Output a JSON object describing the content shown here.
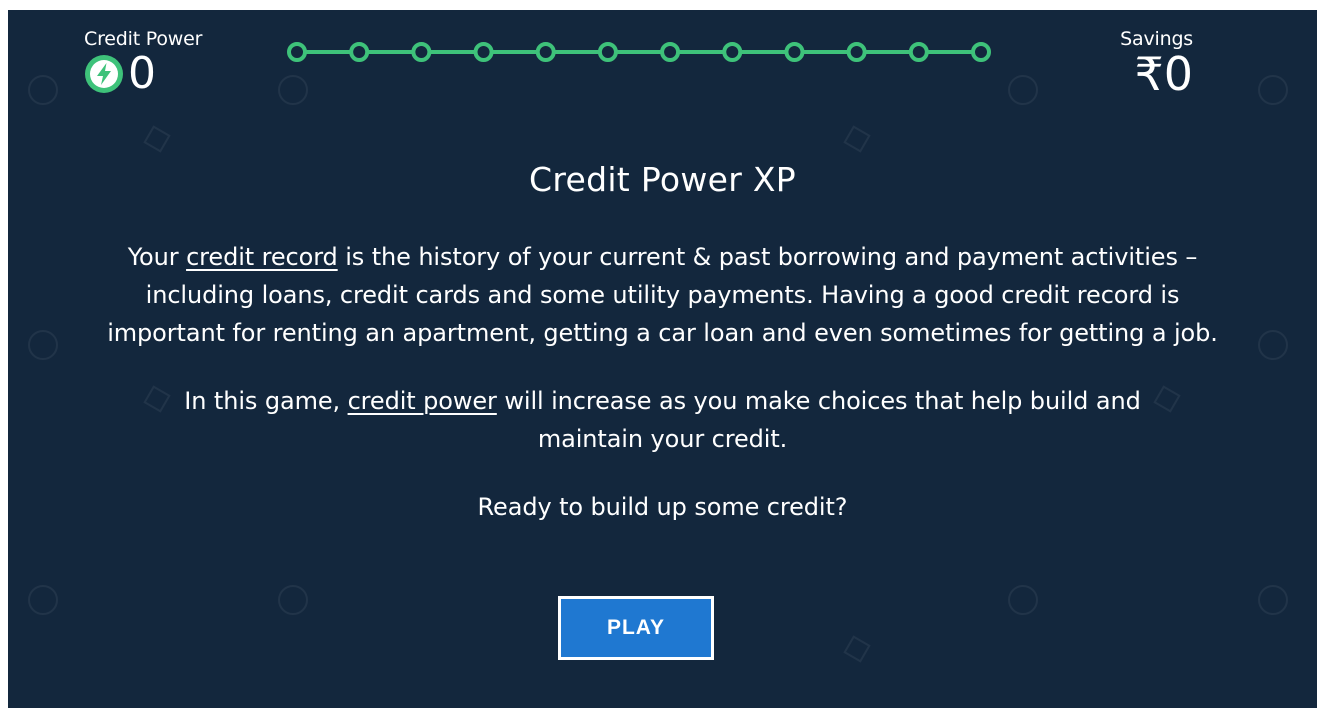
{
  "header": {
    "credit_power_label": "Credit Power",
    "credit_power_value": "0",
    "savings_label": "Savings",
    "savings_value": "₹0",
    "progress_nodes": 12,
    "progress_filled": 0
  },
  "intro": {
    "title": "Credit Power XP",
    "para1_prefix": "Your ",
    "para1_link": "credit record",
    "para1_suffix": " is the history of your current & past borrowing and payment activities – including loans, credit cards and some utility payments. Having a good credit record is important for renting an apartment, getting a car loan and even sometimes for getting a job.",
    "para2_prefix": "In this game, ",
    "para2_link": "credit power",
    "para2_suffix": " will increase as you make choices that help build and maintain your credit.",
    "prompt": "Ready to build up some credit?",
    "play_label": "PLAY"
  },
  "colors": {
    "background": "#13273d",
    "accent_green": "#3ec27a",
    "button_blue": "#1f78d1"
  },
  "icons": {
    "credit": "lightning-bolt-icon"
  }
}
